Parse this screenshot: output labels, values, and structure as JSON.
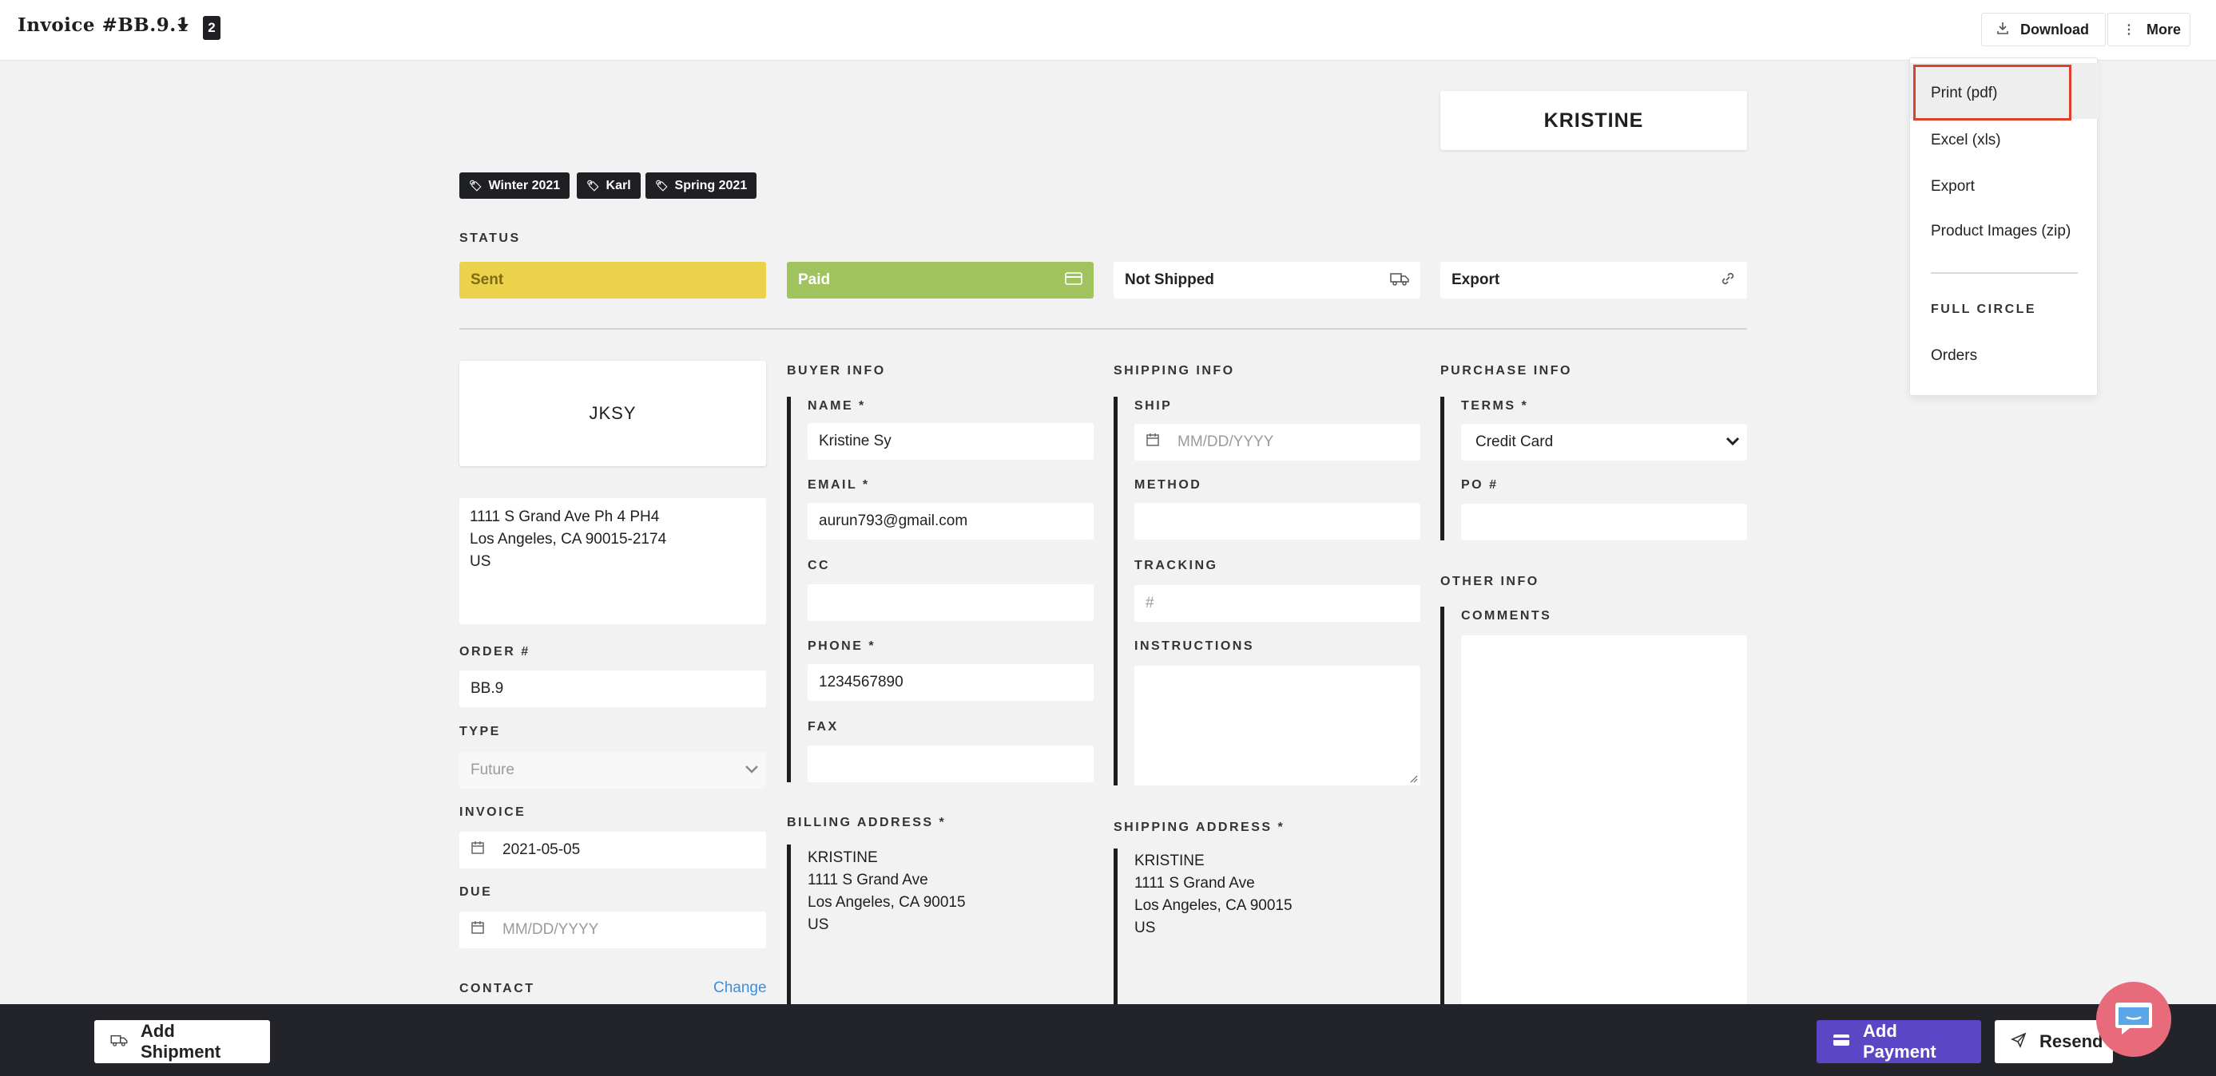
{
  "header": {
    "invoice_title": "Invoice #BB.9.1",
    "count_badge": "2",
    "download_label": "Download",
    "more_label": "More"
  },
  "menu": {
    "items": [
      "Print (pdf)",
      "Excel (xls)",
      "Export",
      "Product Images (zip)"
    ],
    "section_title": "FULL CIRCLE",
    "section_items": [
      "Orders"
    ]
  },
  "retailer_card": "KRISTINE",
  "tags": [
    "Winter 2021",
    "Karl",
    "Spring 2021"
  ],
  "status": {
    "label": "STATUS",
    "items": [
      {
        "label": "Sent",
        "color": "#ecd24a"
      },
      {
        "label": "Paid",
        "color": "#a1c35e"
      },
      {
        "label": "Not Shipped",
        "color": "#ffffff"
      },
      {
        "label": "Export",
        "color": "#ffffff"
      }
    ]
  },
  "left_col": {
    "company_card": "JKSY",
    "address_lines": [
      "1111 S Grand Ave Ph 4 PH4",
      "Los Angeles, CA 90015-2174",
      "US"
    ],
    "order_label": "ORDER #",
    "order_value": "BB.9",
    "type_label": "TYPE",
    "type_placeholder": "Future",
    "invoice_label": "INVOICE",
    "invoice_value": "2021-05-05",
    "due_label": "DUE",
    "due_placeholder": "MM/DD/YYYY",
    "contact_label": "CONTACT",
    "change_link": "Change"
  },
  "buyer": {
    "title": "BUYER INFO",
    "name_label": "NAME *",
    "name_value": "Kristine Sy",
    "email_label": "EMAIL *",
    "email_value": "aurun793@gmail.com",
    "cc_label": "CC",
    "phone_label": "PHONE *",
    "phone_value": "1234567890",
    "fax_label": "FAX",
    "billing_title": "BILLING ADDRESS *",
    "billing_lines": [
      "KRISTINE",
      "1111 S Grand Ave",
      "Los Angeles, CA 90015",
      "US"
    ]
  },
  "shipping": {
    "title": "SHIPPING INFO",
    "ship_label": "SHIP",
    "ship_placeholder": "MM/DD/YYYY",
    "method_label": "METHOD",
    "tracking_label": "TRACKING",
    "tracking_placeholder": "#",
    "instructions_label": "INSTRUCTIONS",
    "address_title": "SHIPPING ADDRESS *",
    "address_lines": [
      "KRISTINE",
      "1111 S Grand Ave",
      "Los Angeles, CA 90015",
      "US"
    ]
  },
  "purchase": {
    "title": "PURCHASE INFO",
    "terms_label": "TERMS *",
    "terms_value": "Credit Card",
    "po_label": "PO #",
    "other_title": "OTHER INFO",
    "comments_label": "COMMENTS"
  },
  "footer": {
    "add_shipment": "Add Shipment",
    "add_payment": "Add Payment",
    "resend": "Resend",
    "add_payment_color": "#5b46c6"
  }
}
